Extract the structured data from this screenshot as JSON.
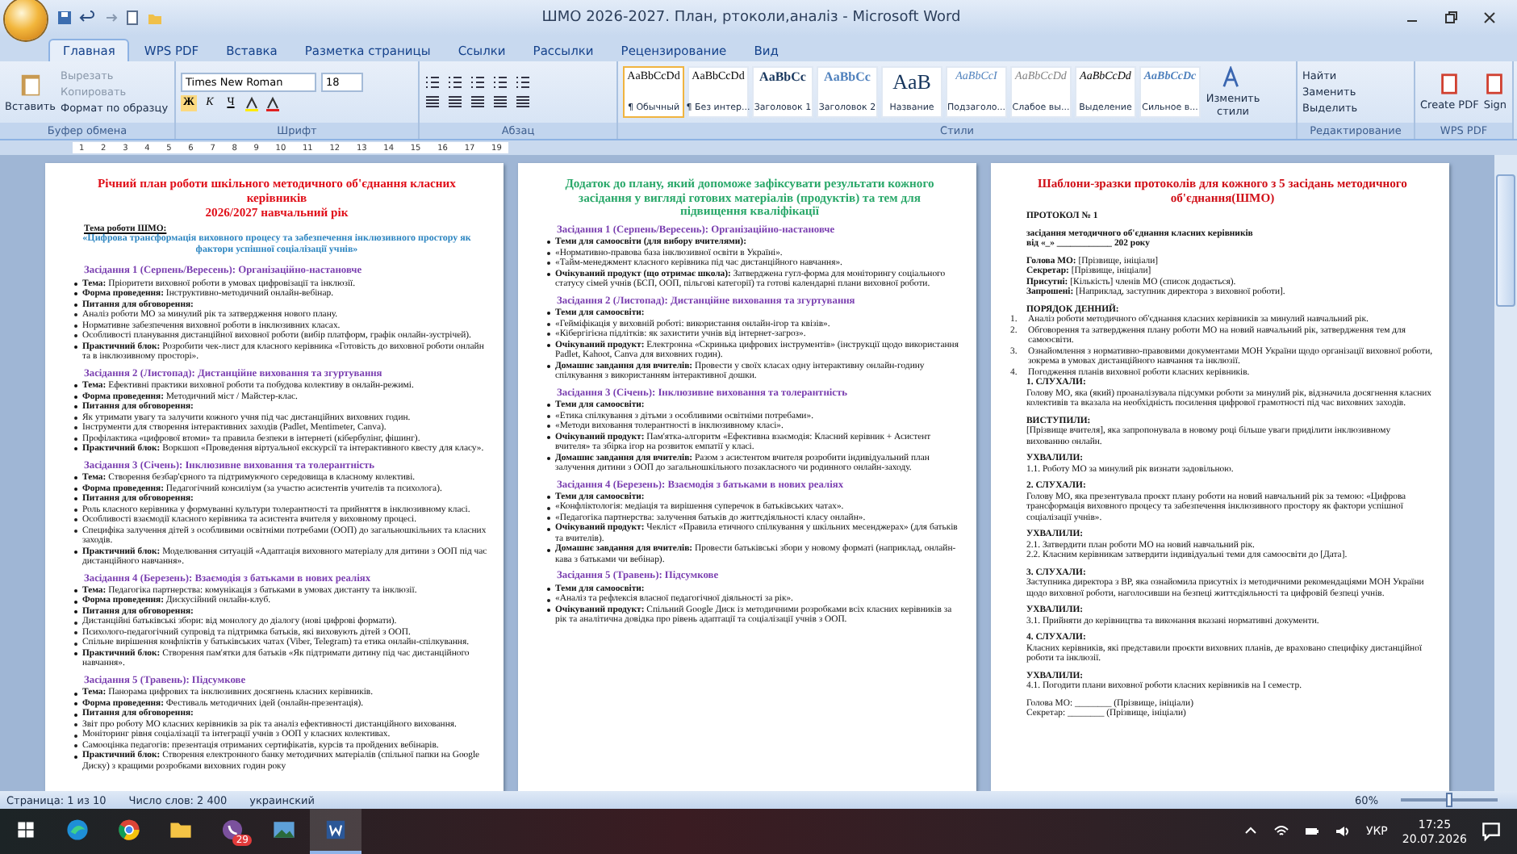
{
  "window": {
    "title": "ШМО 2026-2027. План, ртоколи,аналіз - Microsoft Word"
  },
  "tabs": [
    {
      "label": "Главная",
      "selected": true
    },
    {
      "label": "WPS PDF",
      "selected": false
    },
    {
      "label": "Вставка",
      "selected": false
    },
    {
      "label": "Разметка страницы",
      "selected": false
    },
    {
      "label": "Ссылки",
      "selected": false
    },
    {
      "label": "Рассылки",
      "selected": false
    },
    {
      "label": "Рецензирование",
      "selected": false
    },
    {
      "label": "Вид",
      "selected": false
    }
  ],
  "clipboard": {
    "label": "Буфер обмена",
    "paste": "Вставить",
    "items": [
      {
        "label": "Вырезать",
        "disabled": true
      },
      {
        "label": "Копировать",
        "disabled": true
      },
      {
        "label": "Формат по образцу",
        "disabled": false
      }
    ]
  },
  "font": {
    "label": "Шрифт",
    "name": "Times New Roman",
    "size": "18",
    "buttons": [
      "Ж",
      "К",
      "Ч"
    ]
  },
  "paragraph": {
    "label": "Абзац"
  },
  "styles": {
    "label": "Стили",
    "change": "Изменить стили",
    "items": [
      {
        "sample": "AaBbCcDd",
        "name": "¶ Обычный",
        "kind": "normal",
        "selected": true
      },
      {
        "sample": "AaBbCcDd",
        "name": "¶ Без интер...",
        "kind": "normal",
        "selected": false
      },
      {
        "sample": "AaBbCc",
        "name": "Заголовок 1",
        "kind": "heading",
        "selected": false
      },
      {
        "sample": "AaBbCc",
        "name": "Заголовок 2",
        "kind": "heading2",
        "selected": false
      },
      {
        "sample": "AaB",
        "name": "Название",
        "kind": "title",
        "selected": false
      },
      {
        "sample": "AaBbCcI",
        "name": "Подзаголо...",
        "kind": "subtitle",
        "selected": false
      },
      {
        "sample": "AaBbCcDd",
        "name": "Слабое вы...",
        "kind": "subtle",
        "selected": false
      },
      {
        "sample": "AaBbCcDd",
        "name": "Выделение",
        "kind": "emphasis",
        "selected": false
      },
      {
        "sample": "AaBbCcDc",
        "name": "Сильное в...",
        "kind": "strong",
        "selected": false
      }
    ]
  },
  "editing": {
    "label": "Редактирование",
    "items": [
      "Найти",
      "Заменить",
      "Выделить"
    ]
  },
  "wps": {
    "label": "WPS PDF",
    "items": [
      "Create PDF",
      "Sign"
    ]
  },
  "ruler": [
    "1",
    "2",
    "3",
    "4",
    "5",
    "6",
    "7",
    "8",
    "9",
    "10",
    "11",
    "12",
    "13",
    "14",
    "15",
    "16",
    "17",
    "19"
  ],
  "pages": [
    {
      "color": "#e0101a",
      "blocks": [
        {
          "kind": "title",
          "text": "Річний план роботи шкільного методичного об'єднання класних керівників"
        },
        {
          "kind": "title",
          "text": "2026/2027  навчальний рік"
        },
        {
          "kind": "label",
          "text": "Тема роботи ШМО:"
        },
        {
          "kind": "theme",
          "text": "«Цифрова трансформація виховного процесу та забезпечення інклюзивного простору як фактори успішної соціалізації учнів»"
        },
        {
          "kind": "heading",
          "text": "Засідання 1 (Серпень/Вересень):  Організаційно-настановче"
        },
        {
          "kind": "bullet",
          "text": "**Тема:** Пріоритети виховної роботи в умовах цифровізації та інклюзії."
        },
        {
          "kind": "bullet",
          "text": "**Форма проведення:** Інструктивно-методичний  онлайн-вебінар."
        },
        {
          "kind": "bold_bullet",
          "text": "Питання для обговорення:"
        },
        {
          "kind": "sub",
          "text": "Аналіз роботи МО за минулий рік та затвердження нового плану."
        },
        {
          "kind": "sub",
          "text": "Нормативне забезпечення виховної роботи в інклюзивних класах."
        },
        {
          "kind": "sub",
          "text": "Особливості планування  дистанційної  виховної роботи (вибір платформ, графік онлайн-зустрічей)."
        },
        {
          "kind": "bullet",
          "text": "**Практичний блок:** Розробити чек-лист  для класного керівника «Готовість до виховної роботи онлайн та в інклюзивному просторі»."
        },
        {
          "kind": "heading",
          "text": "Засідання 2 (Листопад):  Дистанційне виховання та згуртування"
        },
        {
          "kind": "bullet",
          "text": "**Тема:** Ефективні практики виховної роботи та побудова колективу в онлайн-режимі."
        },
        {
          "kind": "bullet",
          "text": "**Форма проведення:** Методичний міст / Майстер-клас."
        },
        {
          "kind": "bold_bullet",
          "text": "Питання для обговорення:"
        },
        {
          "kind": "sub",
          "text": "Як утримати увагу та залучити кожного учня під час дистанційних  виховних годин."
        },
        {
          "kind": "sub",
          "text": "Інструменти для створення інтерактивних  заходів (Padlet, Mentimeter,  Canva)."
        },
        {
          "kind": "sub",
          "text": "Профілактика «цифрової втоми» та правила безпеки в інтернеті (кібербулінг,  фішинг)."
        },
        {
          "kind": "bullet",
          "text": "**Практичний блок:** Воркшоп «Проведення віртуальної екскурсії та інтерактивного  квесту для класу»."
        },
        {
          "kind": "heading",
          "text": "Засідання 3 (Січень): Інклюзивне виховання та толерантність"
        },
        {
          "kind": "bullet",
          "text": "**Тема:** Створення безбар'єрного та підтримуючого середовища в класному колективі."
        },
        {
          "kind": "bullet",
          "text": "**Форма проведення:** Педагогічний консиліум (за участю асистентів  учителів та психолога)."
        },
        {
          "kind": "bold_bullet",
          "text": "Питання для обговорення:"
        },
        {
          "kind": "sub",
          "text": "Роль класного керівника у формуванні культури толерантності  та прийняття в інклюзивному класі."
        },
        {
          "kind": "sub",
          "text": "Особливості взаємодії класного керівника та асистента  вчителя у виховному процесі."
        },
        {
          "kind": "sub",
          "text": "Специфіка залучення  дітей з особливими освітніми потребами (ООП) до загальношкільних та класних заходів."
        },
        {
          "kind": "bullet",
          "text": "**Практичний блок:** Моделювання ситуацій  «Адаптація виховного матеріалу для дитини з ООП під час дистанційного  навчання»."
        },
        {
          "kind": "heading",
          "text": "Засідання 4 (Березень):  Взаємодія з батьками в нових реаліях"
        },
        {
          "kind": "bullet",
          "text": "**Тема:** Педагогіка партнерства: комунікація  з батьками в умовах дистанту  та інклюзії."
        },
        {
          "kind": "bullet",
          "text": "**Форма проведення:** Дискусійний  онлайн-клуб."
        },
        {
          "kind": "bold_bullet",
          "text": "Питання для обговорення:"
        },
        {
          "kind": "sub",
          "text": "Дистанційні  батьківські збори: від монологу до діалогу (нові цифрові формати)."
        },
        {
          "kind": "sub",
          "text": "Психолого-педагогічний  супровід та підтримка  батьків, які виховують дітей з ООП."
        },
        {
          "kind": "sub",
          "text": "Спільне вирішення конфліктів  у батьківських чатах (Viber, Telegram)  та етика онлайн-спілкування."
        },
        {
          "kind": "bullet",
          "text": "**Практичний блок:** Створення пам'ятки для батьків «Як підтримати  дитину під час дистанційного навчання»."
        },
        {
          "kind": "heading",
          "text": "Засідання 5 (Травень): Підсумкове"
        },
        {
          "kind": "bullet",
          "text": "**Тема:** Панорама цифрових та інклюзивних  досягнень класних керівників."
        },
        {
          "kind": "bullet",
          "text": "**Форма проведення:** Фестиваль методичних ідей (онлайн-презентація)."
        },
        {
          "kind": "bold_bullet",
          "text": "Питання для обговорення:"
        },
        {
          "kind": "sub",
          "text": "Звіт про роботу МО класних  керівників за рік та аналіз ефективності  дистанційного  виховання."
        },
        {
          "kind": "sub",
          "text": "Моніторинг рівня соціалізації  та інтеграції учнів з ООП у класних колективах."
        },
        {
          "kind": "sub",
          "text": "Самооцінка педагогів: презентація  отриманих  сертифікатів,  курсів та пройдених  вебінарів."
        },
        {
          "kind": "bullet",
          "text": "**Практичний блок:** Створення електронного банку методичних  матеріалів (спільної папки на Google Диску) з кращими розробками виховних годин року"
        }
      ]
    },
    {
      "color": "#2aa86a",
      "blocks": [
        {
          "kind": "title",
          "text": "Додаток до плану, який допоможе зафіксувати результати кожного засідання у вигляді готових матеріалів (продуктів) та тем для підвищення кваліфікації"
        },
        {
          "kind": "heading",
          "text": "Засідання 1 (Серпень/Вересень):  Організаційно-настановче"
        },
        {
          "kind": "bold_bullet",
          "text": "Теми для самоосвіти (для вибору вчителями):"
        },
        {
          "kind": "sub",
          "text": "«Нормативно-правова база інклюзивної освіти в Україні»."
        },
        {
          "kind": "sub",
          "text": "«Тайм-менеджмент класного керівника під час дистанційного  навчання»."
        },
        {
          "kind": "bullet",
          "text": "**Очікуваний продукт (що отримає школа):** Затверджена гугл-форма для моніторингу соціального статусу сімей учнів (БСП, ООП, пільгові категорії) та готові календарні  плани виховної роботи."
        },
        {
          "kind": "heading",
          "text": "Засідання 2 (Листопад): Дистанційне виховання та згуртування"
        },
        {
          "kind": "bold_bullet",
          "text": "Теми для самоосвіти:"
        },
        {
          "kind": "sub",
          "text": "«Гейміфікація у виховній роботі: використання  онлайн-ігор  та квізів»."
        },
        {
          "kind": "sub",
          "text": "«Кібергігієна підлітків: як захистити учнів від інтернет-загроз»."
        },
        {
          "kind": "bullet",
          "text": "**Очікуваний продукт:** Електронна «Скринька цифрових інструментів»  (інструкції щодо використання Padlet, Kahoot, Canva для виховних годин)."
        },
        {
          "kind": "bullet",
          "text": "**Домашнє завдання для вчителів:** Провести у своїх класах одну інтерактивну  онлайн-годину спілкування з використанням  інтерактивної  дошки."
        },
        {
          "kind": "heading",
          "text": "Засідання 3 (Січень): Інклюзивне виховання та толерантність"
        },
        {
          "kind": "bold_bullet",
          "text": "Теми для самоосвіти:"
        },
        {
          "kind": "sub",
          "text": "«Етика спілкування  з дітьми з особливими освітніми потребами»."
        },
        {
          "kind": "sub",
          "text": "«Методи виховання толерантності в інклюзивному класі»."
        },
        {
          "kind": "bullet",
          "text": "**Очікуваний продукт:** Пам'ятка-алгоритм «Ефективна взаємодія: Класний керівник + Асистент вчителя» та збірка ігор на розвиток емпатії у класі."
        },
        {
          "kind": "bullet",
          "text": "**Домашнє завдання для вчителів:** Разом з асистентом  вчителя розробити індивідуальний план залучення дитини  з ООП до загальношкільного позакласного чи родинного онлайн-заходу."
        },
        {
          "kind": "heading",
          "text": "Засідання 4 (Березень):  Взаємодія з батьками в нових реаліях"
        },
        {
          "kind": "bold_bullet",
          "text": "Теми для самоосвіти:"
        },
        {
          "kind": "sub",
          "text": "«Конфліктологія: медіація та вирішення  суперечок в батьківських чатах»."
        },
        {
          "kind": "sub",
          "text": "«Педагогіка партнерства:  залучення батьків до життєдіяльності класу онлайн»."
        },
        {
          "kind": "bullet",
          "text": "**Очікуваний продукт:** Чекліст «Правила етичного  спілкування у шкільних месенджерах»  (для батьків та вчителів)."
        },
        {
          "kind": "bullet",
          "text": "**Домашнє завдання для вчителів:** Провести батьківські збори у новому форматі (наприклад, онлайн-кава з батьками чи вебінар)."
        },
        {
          "kind": "heading",
          "text": "Засідання 5 (Травень): Підсумкове"
        },
        {
          "kind": "bold_bullet",
          "text": "Теми для самоосвіти:"
        },
        {
          "kind": "sub",
          "text": "«Аналіз та рефлексія власної педагогічної  діяльності за рік»."
        },
        {
          "kind": "bullet",
          "text": "**Очікуваний продукт:** Спільний Google Диск  із методичними розробками всіх класних керівників за рік та аналітична  довідка про рівень адаптації  та соціалізації  учнів з ООП."
        }
      ]
    },
    {
      "color": "#d01018",
      "blocks": [
        {
          "kind": "title",
          "text": "Шаблони-зразки протоколів для кожного з 5 засідань методичного об'єднання(ШМО)"
        },
        {
          "kind": "bold",
          "text": "ПРОТОКОЛ № 1"
        },
        {
          "kind": "bold",
          "text": "засідання методичного об'єднання класних керівників"
        },
        {
          "kind": "bold_tight",
          "text": "від «_» ____________ 202   року"
        },
        {
          "kind": "para",
          "text": "**Голова МО:** [Прізвище, ініціали]"
        },
        {
          "kind": "para_tight",
          "text": "**Секретар:** [Прізвище, ініціали]"
        },
        {
          "kind": "para_tight",
          "text": "**Присутні:** [Кількість] членів МО (список додається)."
        },
        {
          "kind": "para_tight",
          "text": "**Запрошені:** [Наприклад, заступник директора з виховної роботи]."
        },
        {
          "kind": "bold",
          "text": "ПОРЯДОК ДЕННИЙ:"
        },
        {
          "kind": "num",
          "marker": "1.",
          "text": "Аналіз роботи методичного об'єднання  класних керівників  за минулий навчальний рік."
        },
        {
          "kind": "num",
          "marker": "2.",
          "text": "Обговорення та затвердження плану роботи МО на новий навчальний рік, затвердження тем для самоосвіти."
        },
        {
          "kind": "num",
          "marker": "3.",
          "text": "Ознайомлення з нормативно-правовими документами МОН України щодо організації  виховної роботи, зокрема в умовах дистанційного  навчання та інклюзії."
        },
        {
          "kind": "num",
          "marker": "4.",
          "text": "Погодження планів  виховної роботи класних керівників."
        },
        {
          "kind": "bold_tight",
          "text": "1. СЛУХАЛИ:"
        },
        {
          "kind": "para_tight",
          "text": "Голову МО, яка (який) проаналізувала  підсумки роботи за минулий рік, відзначила досягнення класних колективів та вказала на необхідність  посилення цифрової грамотності під час виховних заходів."
        },
        {
          "kind": "bold",
          "text": "ВИСТУПИЛИ:"
        },
        {
          "kind": "para_tight",
          "text": "[Прізвище вчителя], яка запропонувала в новому році більше уваги приділити  інклюзивному вихованню онлайн."
        },
        {
          "kind": "bold",
          "text": "УХВАЛИЛИ:"
        },
        {
          "kind": "para_tight",
          "text": "1.1. Роботу МО за минулий рік визнати задовільною."
        },
        {
          "kind": "bold",
          "text": "2. СЛУХАЛИ:"
        },
        {
          "kind": "para_tight",
          "text": "Голову МО, яка презентувала проєкт плану роботи на новий навчальний рік за темою: «Цифрова трансформація виховного процесу  та забезпечення  інклюзивного простору як фактори успішної соціалізації  учнів»."
        },
        {
          "kind": "bold",
          "text": "УХВАЛИЛИ:"
        },
        {
          "kind": "para_tight",
          "text": "2.1. Затвердити план роботи МО на новий навчальний рік."
        },
        {
          "kind": "para_tight",
          "text": "2.2. Класним керівникам  затвердити індивідуальні  теми для самоосвіти  до [Дата]."
        },
        {
          "kind": "bold",
          "text": "3. СЛУХАЛИ:"
        },
        {
          "kind": "para_tight",
          "text": "Заступника директора з ВР, яка ознайомила присутніх  із методичними  рекомендаціями МОН України щодо виховної роботи, наголосивши на безпеці  життєдіяльності  та цифровій безпеці учнів."
        },
        {
          "kind": "bold",
          "text": "УХВАЛИЛИ:"
        },
        {
          "kind": "para_tight",
          "text": "3.1. Прийняти до керівництва  та виконання  вказані нормативні  документи."
        },
        {
          "kind": "bold",
          "text": "4. СЛУХАЛИ:"
        },
        {
          "kind": "para_tight",
          "text": "Класних керівників, які представили проєкти виховних планів, де враховано специфіку дистанційної  роботи та інклюзії."
        },
        {
          "kind": "bold",
          "text": "УХВАЛИЛИ:"
        },
        {
          "kind": "para_tight",
          "text": "4.1. Погодити плани виховної роботи класних керівників на I семестр."
        },
        {
          "kind": "para",
          "text": "Голова МО: ________ (Прізвище, ініціали)"
        },
        {
          "kind": "para_tight",
          "text": "Секретар: ________ (Прізвище, ініціали)"
        }
      ]
    }
  ],
  "status_bar": {
    "page": "Страница: 1 из 10",
    "words": "Число слов: 2 400",
    "language": "украинский",
    "zoom": "60%",
    "level": 0.5
  },
  "taskbar": {
    "apps": [
      {
        "kind": "edge",
        "active": false
      },
      {
        "kind": "chrome",
        "active": false
      },
      {
        "kind": "folder",
        "active": false
      },
      {
        "kind": "viber",
        "active": false,
        "badge": "29"
      },
      {
        "kind": "photos",
        "active": false
      },
      {
        "kind": "word",
        "active": true
      }
    ],
    "language": "УКР",
    "time": "17:25",
    "date": "20.07.2026"
  }
}
